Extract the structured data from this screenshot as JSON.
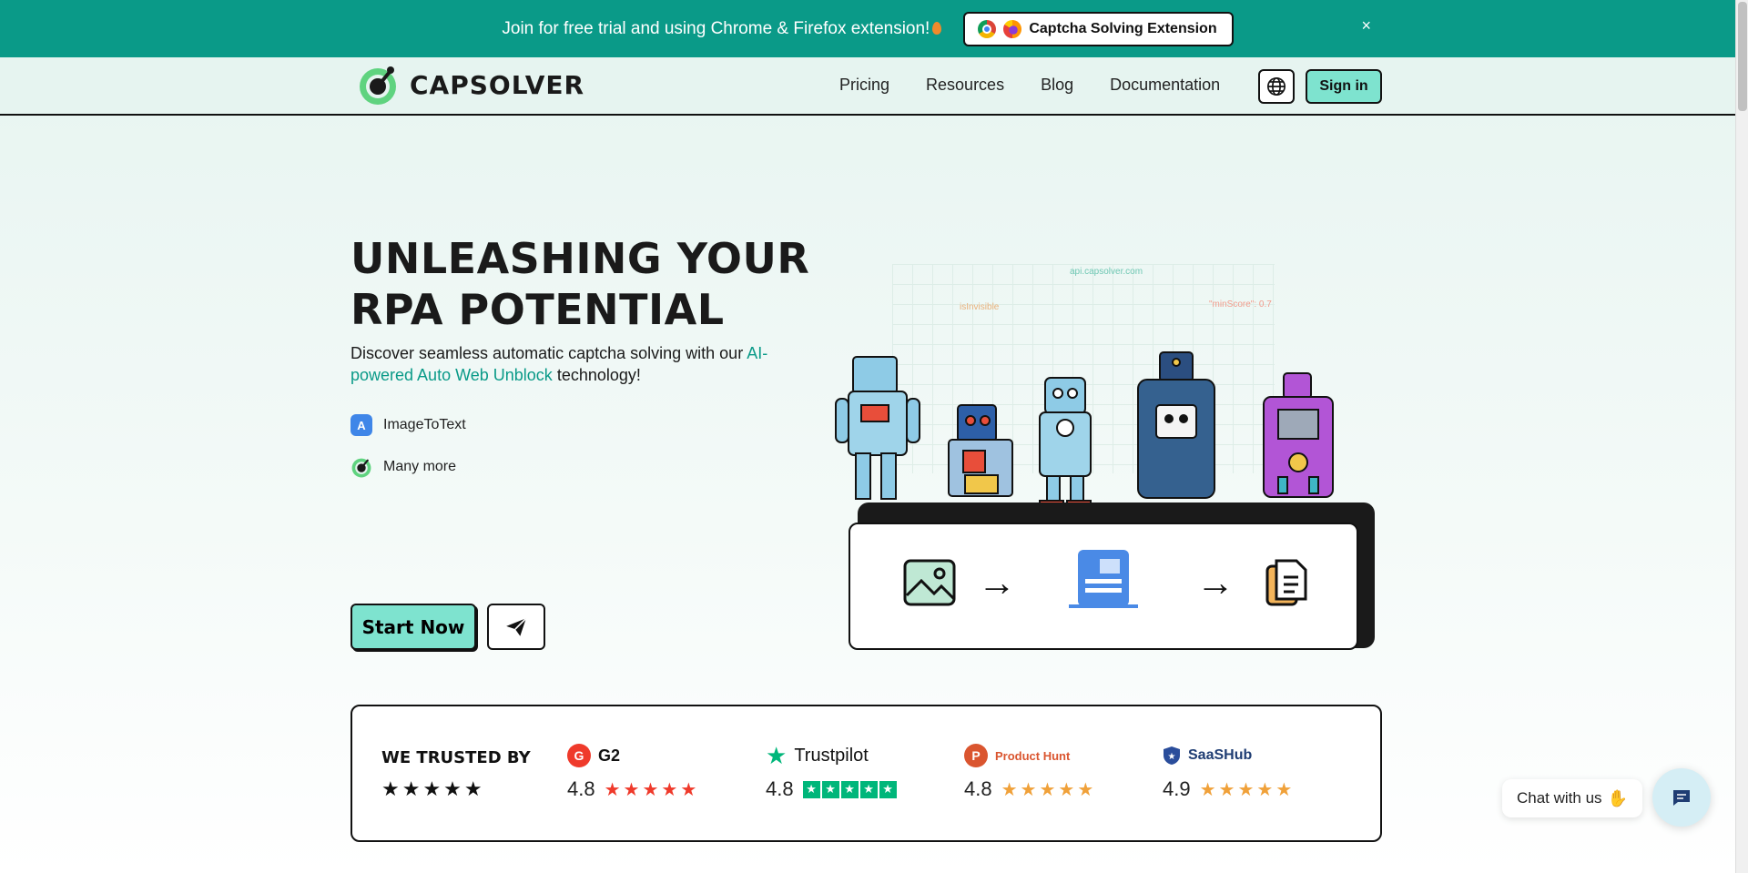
{
  "banner": {
    "text": "Join for free trial and using Chrome & Firefox extension!",
    "cta_label": "Captcha Solving Extension",
    "close": "×"
  },
  "header": {
    "logo_text": "CAPSOLVER",
    "nav": [
      "Pricing",
      "Resources",
      "Blog",
      "Documentation"
    ],
    "signin_label": "Sign in"
  },
  "hero": {
    "title_line1": "UNLEASHING YOUR",
    "title_line2": "RPA POTENTIAL",
    "desc_prefix": "Discover seamless automatic captcha solving with our",
    "desc_accent": "AI-powered Auto Web Unblock",
    "desc_suffix": "technology!",
    "features": [
      {
        "icon": "A",
        "label": "ImageToText"
      },
      {
        "icon": "capsolver-logo-icon",
        "label": "Many more"
      }
    ],
    "start_label": "Start Now"
  },
  "illustration": {
    "code_labels": [
      "api.capsolver.com",
      "isInvisible",
      "\"minScore\": 0.7"
    ]
  },
  "trusted": {
    "title": "WE TRUSTED BY",
    "stars": "★★★★★",
    "ratings": [
      {
        "brand": "G2",
        "score": "4.8",
        "stars": "★★★★★"
      },
      {
        "brand": "Trustpilot",
        "score": "4.8",
        "stars": "★★★★★"
      },
      {
        "brand": "Product Hunt",
        "score": "4.8",
        "stars": "★★★★★"
      },
      {
        "brand": "SaaSHub",
        "score": "4.9",
        "stars": "★★★★★"
      }
    ]
  },
  "chat": {
    "label": "Chat with us"
  },
  "colors": {
    "brand_teal": "#0a9a88",
    "mint": "#7ee3cf",
    "g2_red": "#ef3a2b",
    "trustpilot_green": "#00b67a",
    "producthunt_orange": "#da552f",
    "saashub_blue": "#2a4d9b",
    "star_orange": "#f0a13a"
  }
}
